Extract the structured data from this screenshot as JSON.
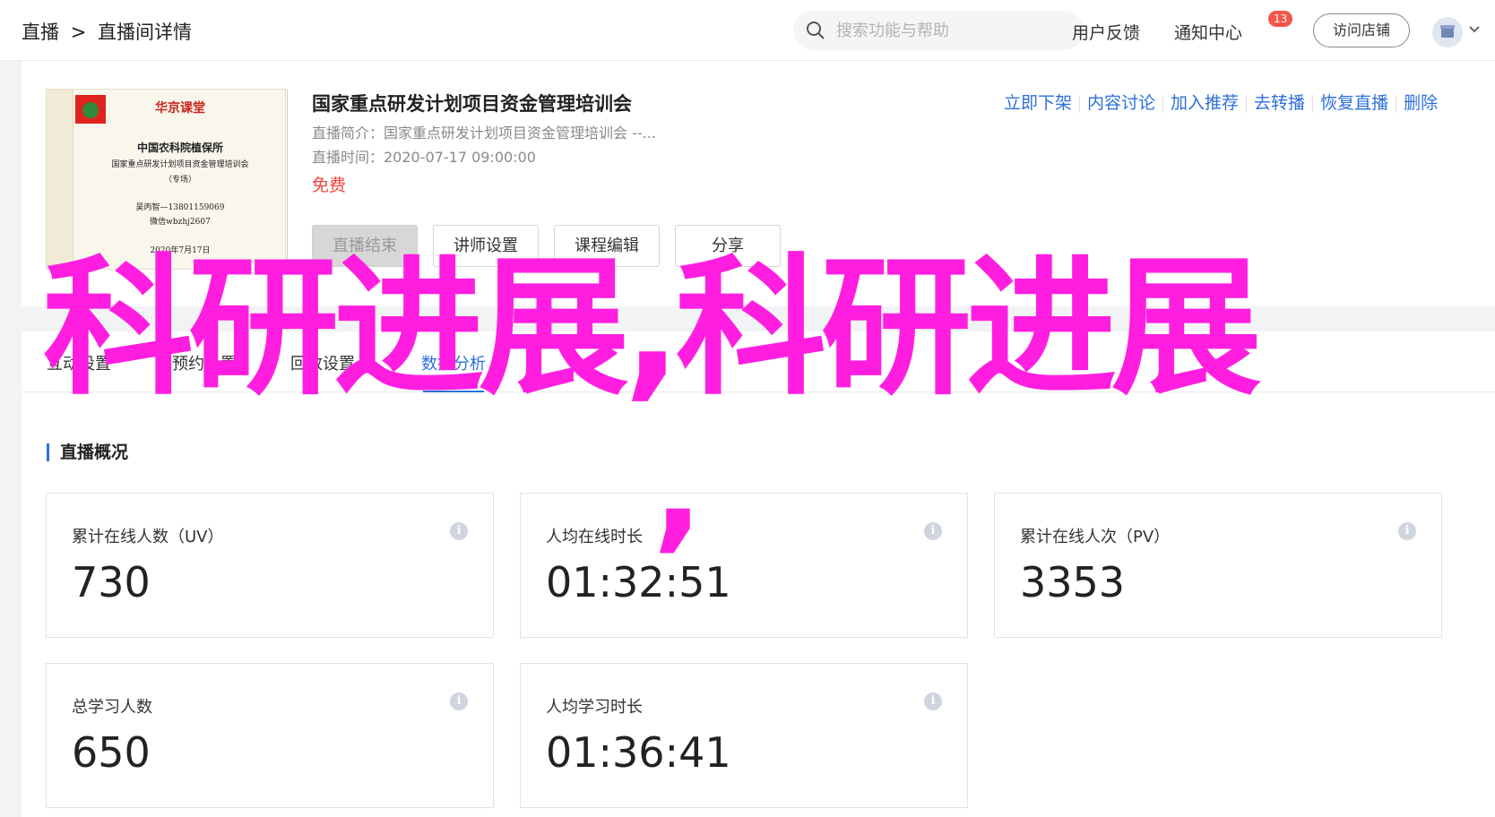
{
  "header": {
    "breadcrumb": [
      "直播",
      ">",
      "直播间详情"
    ],
    "search_placeholder": "搜索功能与帮助",
    "feedback": "用户反馈",
    "notifications": "通知中心",
    "notification_count": "13",
    "visit_store": "访问店铺"
  },
  "course": {
    "title": "国家重点研发计划项目资金管理培训会",
    "intro": "直播简介：国家重点研发计划项目资金管理培训会 --...",
    "time": "直播时间：2020-07-17 09:00:00",
    "price": "免费",
    "actions": [
      "立即下架",
      "内容讨论",
      "加入推荐",
      "去转播",
      "恢复直播",
      "删除"
    ],
    "buttons": [
      "直播结束",
      "讲师设置",
      "课程编辑",
      "分享"
    ],
    "cover": {
      "brand": "华京课堂",
      "org": "中国农科院植保所",
      "name": "国家重点研发计划项目资金管理培训会",
      "sub": "（专场）",
      "contact": "吴丙智—13801159069",
      "wechat": "微信wbzhj2607",
      "date": "2020年7月17日"
    }
  },
  "tabs": [
    "互动设置",
    "预约设置",
    "回放设置",
    "数据分析"
  ],
  "overview": {
    "title": "直播概况",
    "stats": [
      {
        "label": "累计在线人数（UV）",
        "value": "730"
      },
      {
        "label": "人均在线时长",
        "value": "01:32:51"
      },
      {
        "label": "累计在线人次（PV）",
        "value": "3353"
      },
      {
        "label": "总学习人数",
        "value": "650"
      },
      {
        "label": "人均学习时长",
        "value": "01:36:41"
      }
    ]
  },
  "overlay_text": "科研进展,科研进展",
  "overlay_comma": ",",
  "colors": {
    "accent": "#2d6fdc",
    "price": "#f2453d",
    "overlay": "#ff1ee0"
  }
}
